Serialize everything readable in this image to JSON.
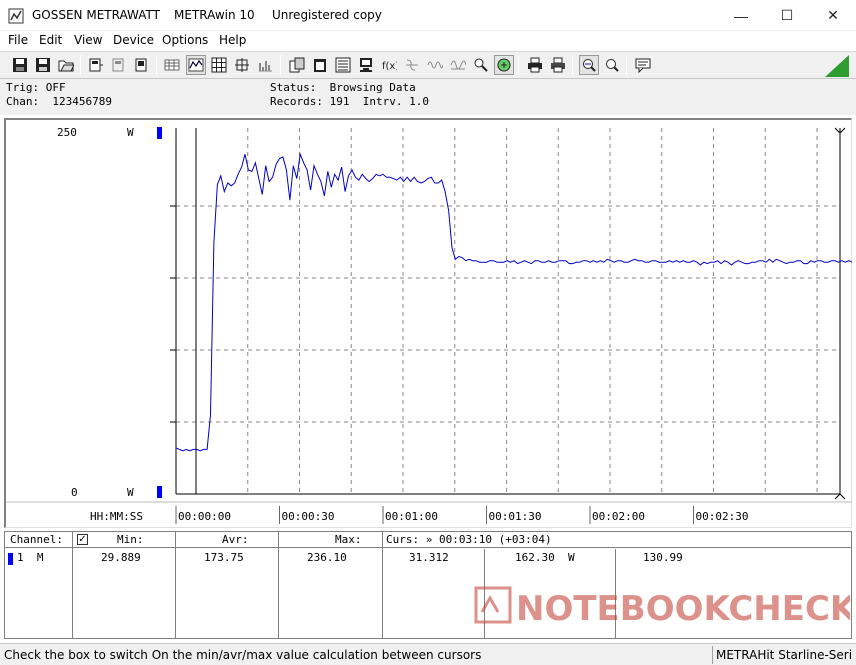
{
  "window": {
    "brand": "GOSSEN METRAWATT",
    "app": "METRAwin 10",
    "license": "Unregistered copy",
    "minimize_glyph": "—",
    "maximize_glyph": "☐",
    "close_glyph": "✕"
  },
  "menu": {
    "file": "File",
    "edit": "Edit",
    "view": "View",
    "device": "Device",
    "options": "Options",
    "help": "Help"
  },
  "status": {
    "trig": "Trig: OFF",
    "chan": "Chan:  123456789",
    "status": "Status:  Browsing Data",
    "records": "Records: 191  Intrv. 1.0"
  },
  "chart_data": {
    "type": "line",
    "ymax_label": "250",
    "ymin_label": "0",
    "yunit_top": "W",
    "yunit_bottom": "W",
    "ylim": [
      0,
      250
    ],
    "time_axis_label": "HH:MM:SS",
    "xticks": [
      "00:00:00",
      "00:00:30",
      "00:01:00",
      "00:01:30",
      "00:02:00",
      "00:02:30"
    ],
    "line_color": "#0000c8",
    "series": [
      {
        "values": [
          32,
          31,
          30,
          31,
          30,
          31,
          31,
          30,
          31,
          31,
          55,
          175,
          215,
          221,
          210,
          216,
          214,
          216,
          222,
          227,
          236,
          225,
          224,
          230,
          219,
          208,
          228,
          217,
          220,
          229,
          233,
          234,
          225,
          204,
          228,
          219,
          236,
          230,
          225,
          211,
          228,
          222,
          217,
          207,
          224,
          213,
          222,
          218,
          227,
          210,
          221,
          225,
          220,
          218,
          222,
          219,
          217,
          219,
          222,
          221,
          222,
          220,
          220,
          219,
          218,
          220,
          217,
          220,
          217,
          220,
          217,
          216,
          217,
          219,
          220,
          216,
          216,
          218,
          210,
          197,
          171,
          163,
          165,
          164,
          162,
          163,
          162,
          162,
          161,
          161,
          161,
          162,
          162,
          161,
          161,
          161,
          162,
          161,
          162,
          160,
          161,
          162,
          161,
          160,
          162,
          162,
          161,
          161,
          162,
          161,
          161,
          162,
          162,
          162,
          160,
          160,
          161,
          161,
          162,
          162,
          161,
          162,
          161,
          162,
          161,
          163,
          162,
          161,
          162,
          162,
          161,
          161,
          162,
          163,
          162,
          162,
          161,
          161,
          162,
          162,
          161,
          161,
          161,
          162,
          161,
          162,
          161,
          162,
          161,
          161,
          162,
          161,
          159,
          161,
          160,
          161,
          161,
          162,
          160,
          162,
          161,
          159,
          161,
          162,
          161,
          160,
          160,
          161,
          161,
          162,
          162,
          161,
          163,
          161,
          163,
          162,
          161,
          160,
          161,
          161,
          162,
          162,
          160,
          160,
          162,
          161,
          162,
          162,
          161,
          161,
          162,
          162,
          161,
          162,
          161,
          162,
          161,
          162,
          160,
          160,
          162,
          161
        ]
      }
    ]
  },
  "table": {
    "headers": {
      "channel": "Channel:",
      "min": "Min:",
      "avr": "Avr:",
      "max": "Max:",
      "curs": "Curs: » 00:03:10 (+03:04)"
    },
    "row": {
      "channel": "1  M",
      "min": "29.889",
      "avr": "173.75",
      "max": "236.10",
      "c1": "31.312",
      "c2": "162.30  W",
      "c3": "130.99"
    }
  },
  "watermark": "NOTEBOOKCHECK",
  "statusbar": {
    "hint": "Check the box to switch On the min/avr/max value calculation between cursors",
    "device": "METRAHit Starline-Seri"
  },
  "colors": {
    "accent_green": "#2e9c2e",
    "plot_blue": "#0000c8",
    "watermark_red": "#c0392b"
  }
}
